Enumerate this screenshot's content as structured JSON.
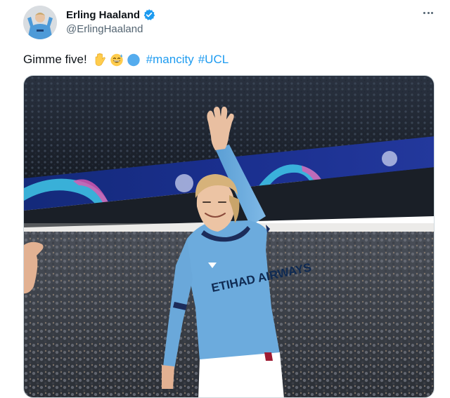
{
  "author": {
    "display_name": "Erling Haaland",
    "handle": "@ErlingHaaland",
    "verified": true
  },
  "tweet": {
    "text": "Gimme five!",
    "emojis": [
      "raised-hand",
      "grinning-sweat-face",
      "blue-circle"
    ],
    "hashtags": [
      "#mancity",
      "#UCL"
    ]
  },
  "media": {
    "jersey_text": "ETIHAD AIRWAYS",
    "colors": {
      "sky_blue": "#6cabdd",
      "stand_dark": "#1e2531",
      "led_board": "#1c2c8c",
      "shorts": "#ffffff"
    }
  },
  "icons": {
    "verified": "verified-badge-icon",
    "more": "more-options-icon"
  }
}
